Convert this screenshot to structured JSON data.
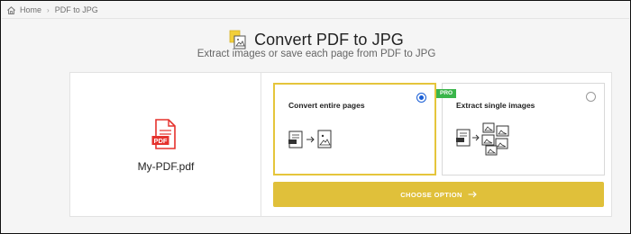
{
  "breadcrumb": {
    "home_label": "Home",
    "separator": "›",
    "current_label": "PDF to JPG"
  },
  "header": {
    "title": "Convert PDF to JPG",
    "subtitle": "Extract images or save each page from PDF to JPG"
  },
  "file": {
    "name": "My-PDF.pdf",
    "icon_text": "PDF",
    "icon_color": "#e5322d"
  },
  "options": [
    {
      "label": "Convert entire pages",
      "selected": true,
      "graphic_icon": "pdf-to-page-icon"
    },
    {
      "label": "Extract single images",
      "selected": false,
      "graphic_icon": "pdf-to-images-icon"
    }
  ],
  "badge": {
    "label": "PRO",
    "color": "#3ab54a"
  },
  "action": {
    "label": "CHOOSE OPTION",
    "color": "#e0c03a"
  },
  "colors": {
    "accent": "#e0c03a",
    "selected_border": "#e5c53b",
    "radio": "#1a5fd6"
  }
}
